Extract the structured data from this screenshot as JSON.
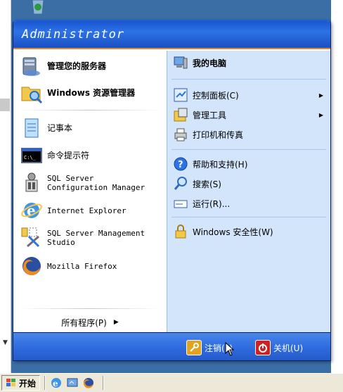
{
  "menu": {
    "user_name": "Administrator"
  },
  "left_items": [
    {
      "label": "管理您的服务器",
      "icon": "server-manager-icon",
      "bold": true
    },
    {
      "label": "Windows 资源管理器",
      "icon": "explorer-folder-icon",
      "bold": true
    },
    {
      "label": "记事本",
      "icon": "notepad-icon",
      "bold": false
    },
    {
      "label": "命令提示符",
      "icon": "cmd-icon",
      "bold": false
    },
    {
      "label": "SQL Server\nConfiguration Manager",
      "icon": "sql-config-icon",
      "bold": false
    },
    {
      "label": "Internet Explorer",
      "icon": "ie-icon",
      "bold": false
    },
    {
      "label": "SQL Server Management\nStudio",
      "icon": "sql-studio-icon",
      "bold": false
    },
    {
      "label": "Mozilla Firefox",
      "icon": "firefox-icon",
      "bold": false
    }
  ],
  "all_programs": {
    "label": "所有程序(P)",
    "arrow": "▶"
  },
  "right_items": [
    {
      "label": "我的电脑",
      "icon": "my-computer-icon",
      "bold": true
    },
    {
      "label": "控制面板(C)",
      "icon": "control-panel-icon",
      "submenu": "▶"
    },
    {
      "label": "管理工具",
      "icon": "admin-tools-icon",
      "submenu": "▶"
    },
    {
      "label": "打印机和传真",
      "icon": "printer-icon"
    },
    {
      "label": "帮助和支持(H)",
      "icon": "help-icon"
    },
    {
      "label": "搜索(S)",
      "icon": "search-icon"
    },
    {
      "label": "运行(R)...",
      "icon": "run-icon"
    },
    {
      "label": "Windows 安全性(W)",
      "icon": "security-icon"
    }
  ],
  "footer": {
    "logoff_label": "注销(L)",
    "shutdown_label": "关机(U)"
  },
  "taskbar": {
    "start_label": "开始"
  },
  "colors": {
    "header": "#2c73e6",
    "right_panel": "#d3e5fa",
    "footer": "#2f6de0",
    "accent": "#e08a2e"
  }
}
